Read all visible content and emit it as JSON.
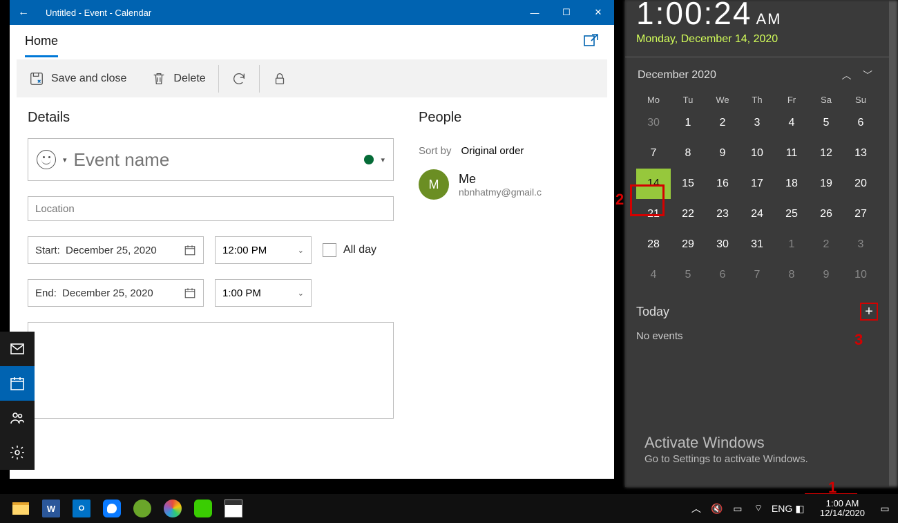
{
  "window": {
    "title": "Untitled - Event - Calendar",
    "tab_home": "Home",
    "ribbon": {
      "save": "Save and close",
      "delete": "Delete"
    }
  },
  "details": {
    "heading": "Details",
    "event_placeholder": "Event name",
    "location_placeholder": "Location",
    "start_label": "Start:",
    "start_date": "December 25, 2020",
    "start_time": "12:00 PM",
    "end_label": "End:",
    "end_date": "December 25, 2020",
    "end_time": "1:00 PM",
    "all_day": "All day"
  },
  "people": {
    "heading": "People",
    "sort_by": "Sort by",
    "sort_value": "Original order",
    "me_initial": "M",
    "me_name": "Me",
    "me_email": "nbnhatmy@gmail.c"
  },
  "flyout": {
    "clock_time": "1:00:24",
    "clock_ampm": "AM",
    "date_string": "Monday, December 14, 2020",
    "month_label": "December 2020",
    "dow": [
      "Mo",
      "Tu",
      "We",
      "Th",
      "Fr",
      "Sa",
      "Su"
    ],
    "weeks": [
      [
        {
          "d": "30",
          "dim": true
        },
        {
          "d": "1"
        },
        {
          "d": "2"
        },
        {
          "d": "3"
        },
        {
          "d": "4"
        },
        {
          "d": "5"
        },
        {
          "d": "6"
        }
      ],
      [
        {
          "d": "7"
        },
        {
          "d": "8"
        },
        {
          "d": "9"
        },
        {
          "d": "10"
        },
        {
          "d": "11"
        },
        {
          "d": "12"
        },
        {
          "d": "13"
        }
      ],
      [
        {
          "d": "14",
          "today": true
        },
        {
          "d": "15"
        },
        {
          "d": "16"
        },
        {
          "d": "17"
        },
        {
          "d": "18"
        },
        {
          "d": "19"
        },
        {
          "d": "20"
        }
      ],
      [
        {
          "d": "21"
        },
        {
          "d": "22"
        },
        {
          "d": "23"
        },
        {
          "d": "24"
        },
        {
          "d": "25"
        },
        {
          "d": "26"
        },
        {
          "d": "27"
        }
      ],
      [
        {
          "d": "28"
        },
        {
          "d": "29"
        },
        {
          "d": "30"
        },
        {
          "d": "31"
        },
        {
          "d": "1",
          "dim": true
        },
        {
          "d": "2",
          "dim": true
        },
        {
          "d": "3",
          "dim": true
        }
      ],
      [
        {
          "d": "4",
          "dim": true
        },
        {
          "d": "5",
          "dim": true
        },
        {
          "d": "6",
          "dim": true
        },
        {
          "d": "7",
          "dim": true
        },
        {
          "d": "8",
          "dim": true
        },
        {
          "d": "9",
          "dim": true
        },
        {
          "d": "10",
          "dim": true
        }
      ]
    ],
    "today_heading": "Today",
    "no_events": "No events",
    "activate_t": "Activate Windows",
    "activate_s": "Go to Settings to activate Windows."
  },
  "annotations": {
    "one": "1",
    "two": "2",
    "three": "3"
  },
  "taskbar": {
    "lang": "ENG",
    "clock_time": "1:00 AM",
    "clock_date": "12/14/2020"
  },
  "colors": {
    "accent": "#0063B1",
    "today_green": "#96c83c",
    "red": "#d40000"
  }
}
